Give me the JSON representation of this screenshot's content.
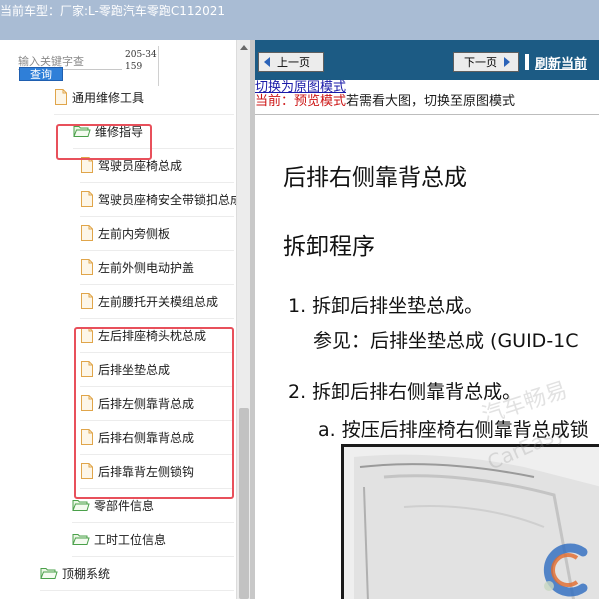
{
  "titlebar": {
    "text": "当前车型：厂家:L-零跑汽车零跑C112021"
  },
  "search": {
    "placeholder": "输入关键字查",
    "button_label": "查询",
    "code": "205-34159"
  },
  "tree": [
    {
      "label": "通用维修工具",
      "icon": "file-icon"
    },
    {
      "label": "维修指导",
      "icon": "folder-open-icon"
    },
    {
      "label": "驾驶员座椅总成",
      "icon": "file-icon"
    },
    {
      "label": "驾驶员座椅安全带锁扣总成",
      "icon": "file-icon"
    },
    {
      "label": "左前内旁侧板",
      "icon": "file-icon"
    },
    {
      "label": "左前外侧电动护盖",
      "icon": "file-icon"
    },
    {
      "label": "左前腰托开关模组总成",
      "icon": "file-icon"
    },
    {
      "label": "左后排座椅头枕总成",
      "icon": "file-icon"
    },
    {
      "label": "后排坐垫总成",
      "icon": "file-icon"
    },
    {
      "label": "后排左侧靠背总成",
      "icon": "file-icon"
    },
    {
      "label": "后排右侧靠背总成",
      "icon": "file-icon"
    },
    {
      "label": "后排靠背左侧锁钩",
      "icon": "file-icon"
    },
    {
      "label": "零部件信息",
      "icon": "folder-open-icon"
    },
    {
      "label": "工时工位信息",
      "icon": "folder-open-icon"
    },
    {
      "label": "顶棚系统",
      "icon": "folder-open-icon"
    }
  ],
  "toolbar": {
    "prev_label": "上一页",
    "next_label": "下一页",
    "refresh_label": "刷新当前"
  },
  "notice": {
    "switch_link": "切换为原图模式",
    "current_prefix": "当前：预览模式",
    "current_suffix": "若需看大图，切换至原图模式"
  },
  "document": {
    "title": "后排右侧靠背总成",
    "subtitle": "拆卸程序",
    "step1": "1. 拆卸后排坐垫总成。",
    "step1_ref": "参见：后排坐垫总成 (GUID-1C",
    "step2": "2. 拆卸后排右侧靠背总成。",
    "step2a": "a. 按压后排座椅右侧靠背总成锁"
  },
  "watermark": {
    "line1": "汽车畅易",
    "line2": "CarEasy"
  },
  "colors": {
    "titlebar": "#a9bcd4",
    "toolbar": "#1c5b84",
    "highlight": "#e8505b",
    "query_button": "#2f7fd8",
    "preview_red": "#cc1414"
  }
}
